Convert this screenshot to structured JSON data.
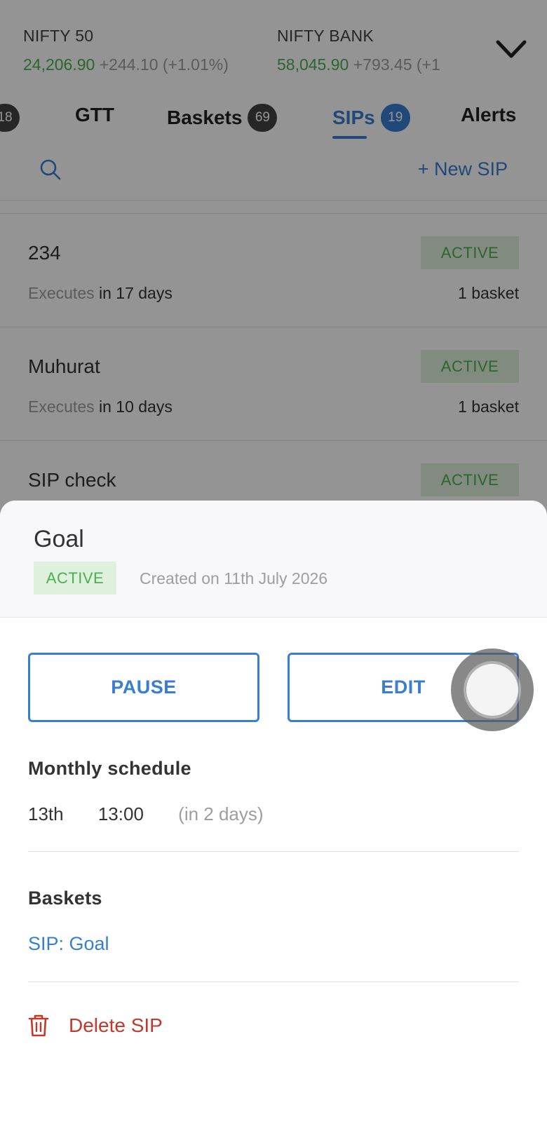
{
  "ticker": [
    {
      "name": "NIFTY 50",
      "price": "24,206.90",
      "change": "+244.10 (+1.01%)"
    },
    {
      "name": "NIFTY BANK",
      "price": "58,045.90",
      "change": "+793.45 (+1"
    }
  ],
  "tabs": [
    {
      "label": "",
      "count": "18"
    },
    {
      "label": "GTT",
      "count": ""
    },
    {
      "label": "Baskets",
      "count": "69"
    },
    {
      "label": "SIPs",
      "count": "19"
    },
    {
      "label": "Alerts",
      "count": ""
    }
  ],
  "search": {
    "new_label": "+ New SIP"
  },
  "sip_list": [
    {
      "name": "234",
      "status": "ACTIVE",
      "exec_prefix": "Executes",
      "exec_when": "in 17 days",
      "baskets": "1 basket"
    },
    {
      "name": "Muhurat",
      "status": "ACTIVE",
      "exec_prefix": "Executes",
      "exec_when": "in 10 days",
      "baskets": "1 basket"
    },
    {
      "name": "SIP check",
      "status": "ACTIVE",
      "exec_prefix": "",
      "exec_when": "",
      "baskets": ""
    }
  ],
  "sheet": {
    "title": "Goal",
    "status": "ACTIVE",
    "created": "Created on 11th July 2026",
    "pause_label": "PAUSE",
    "edit_label": "EDIT",
    "schedule_title": "Monthly schedule",
    "schedule_day": "13th",
    "schedule_time": "13:00",
    "schedule_relative": "(in 2 days)",
    "baskets_title": "Baskets",
    "basket_link": "SIP: Goal",
    "delete_label": "Delete SIP"
  },
  "colors": {
    "accent": "#387ed1",
    "positive": "#4caf50",
    "danger": "#c0392b"
  }
}
